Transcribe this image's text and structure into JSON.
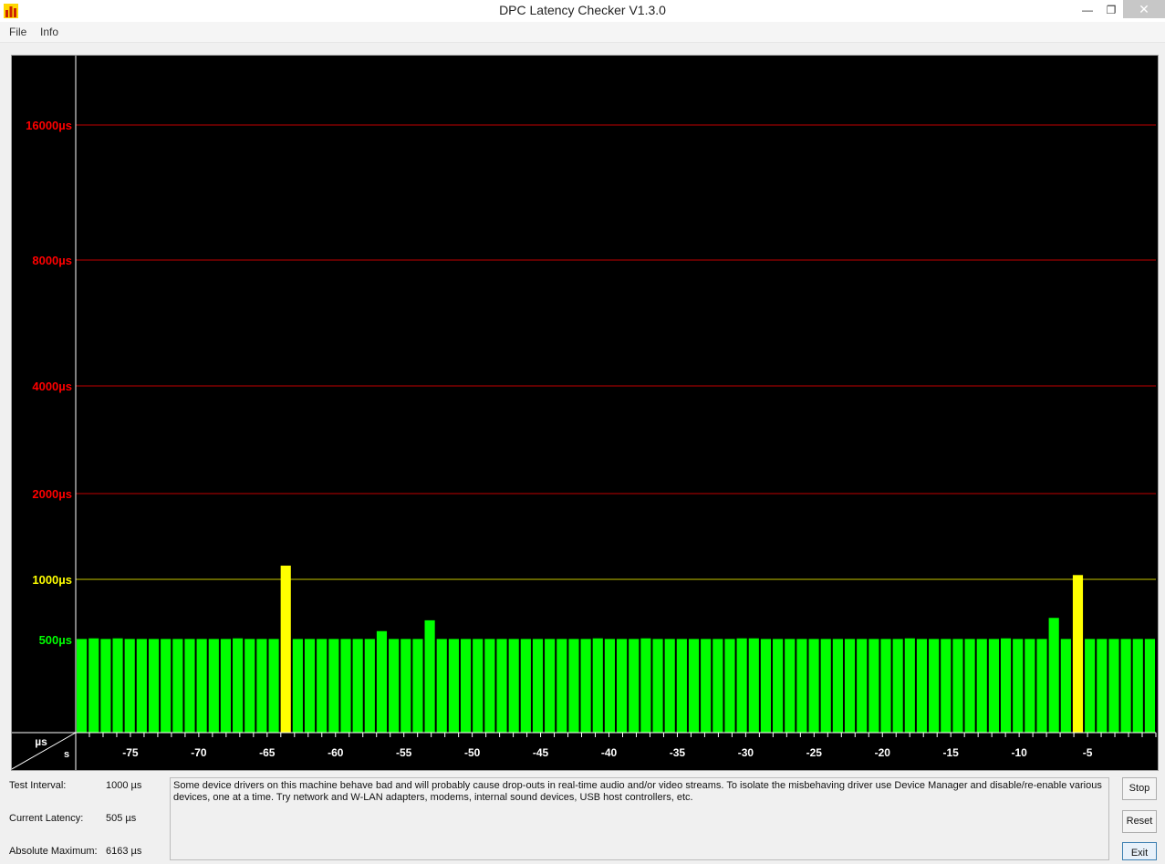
{
  "window": {
    "title": "DPC Latency Checker V1.3.0",
    "minimize_label": "—",
    "restore_label": "❐",
    "close_label": "✕",
    "app_icon": "bar-chart-app-icon"
  },
  "menu": {
    "file": "File",
    "info": "Info"
  },
  "chart_data": {
    "type": "bar",
    "ylabel": "µs",
    "xlabel": "s",
    "y_ticks": [
      {
        "label": "16000µs",
        "value": 16000,
        "color": "#ff0000"
      },
      {
        "label": "8000µs",
        "value": 8000,
        "color": "#ff0000"
      },
      {
        "label": "4000µs",
        "value": 4000,
        "color": "#ff0000"
      },
      {
        "label": "2000µs",
        "value": 2000,
        "color": "#ff0000"
      },
      {
        "label": "1000µs",
        "value": 1000,
        "color": "#ffff00"
      },
      {
        "label": "500µs",
        "value": 500,
        "color": "#00ff00"
      }
    ],
    "x_ticks": [
      "-75",
      "-70",
      "-65",
      "-60",
      "-55",
      "-50",
      "-45",
      "-40",
      "-35",
      "-30",
      "-25",
      "-20",
      "-15",
      "-10",
      "-5"
    ],
    "x_range": [
      -79,
      0
    ],
    "bar_colors": {
      "ok": "#00ff00",
      "warning": "#ffff00"
    },
    "values": [
      505,
      510,
      505,
      510,
      505,
      505,
      505,
      505,
      505,
      505,
      505,
      505,
      505,
      510,
      505,
      505,
      505,
      1160,
      505,
      505,
      505,
      505,
      505,
      505,
      505,
      570,
      505,
      505,
      505,
      660,
      505,
      505,
      505,
      505,
      505,
      505,
      505,
      505,
      505,
      505,
      505,
      505,
      505,
      510,
      505,
      505,
      505,
      510,
      505,
      505,
      505,
      505,
      505,
      505,
      505,
      510,
      510,
      505,
      505,
      505,
      505,
      505,
      505,
      505,
      505,
      505,
      505,
      505,
      505,
      510,
      505,
      505,
      505,
      505,
      505,
      505,
      505,
      510,
      505,
      505,
      505,
      680,
      505,
      1050,
      505,
      505,
      505,
      505,
      505,
      505
    ]
  },
  "status": {
    "test_interval_label": "Test Interval:",
    "test_interval_value": "1000 µs",
    "current_latency_label": "Current Latency:",
    "current_latency_value": "505 µs",
    "absolute_max_label": "Absolute Maximum:",
    "absolute_max_value": "6163 µs"
  },
  "message": "Some device drivers on this machine behave bad and will probably cause drop-outs in real-time audio and/or video streams. To isolate the misbehaving driver use Device Manager and disable/re-enable various devices, one at a time. Try network and W-LAN adapters, modems, internal sound devices, USB host controllers, etc.",
  "buttons": {
    "stop": "Stop",
    "reset": "Reset",
    "exit": "Exit"
  }
}
